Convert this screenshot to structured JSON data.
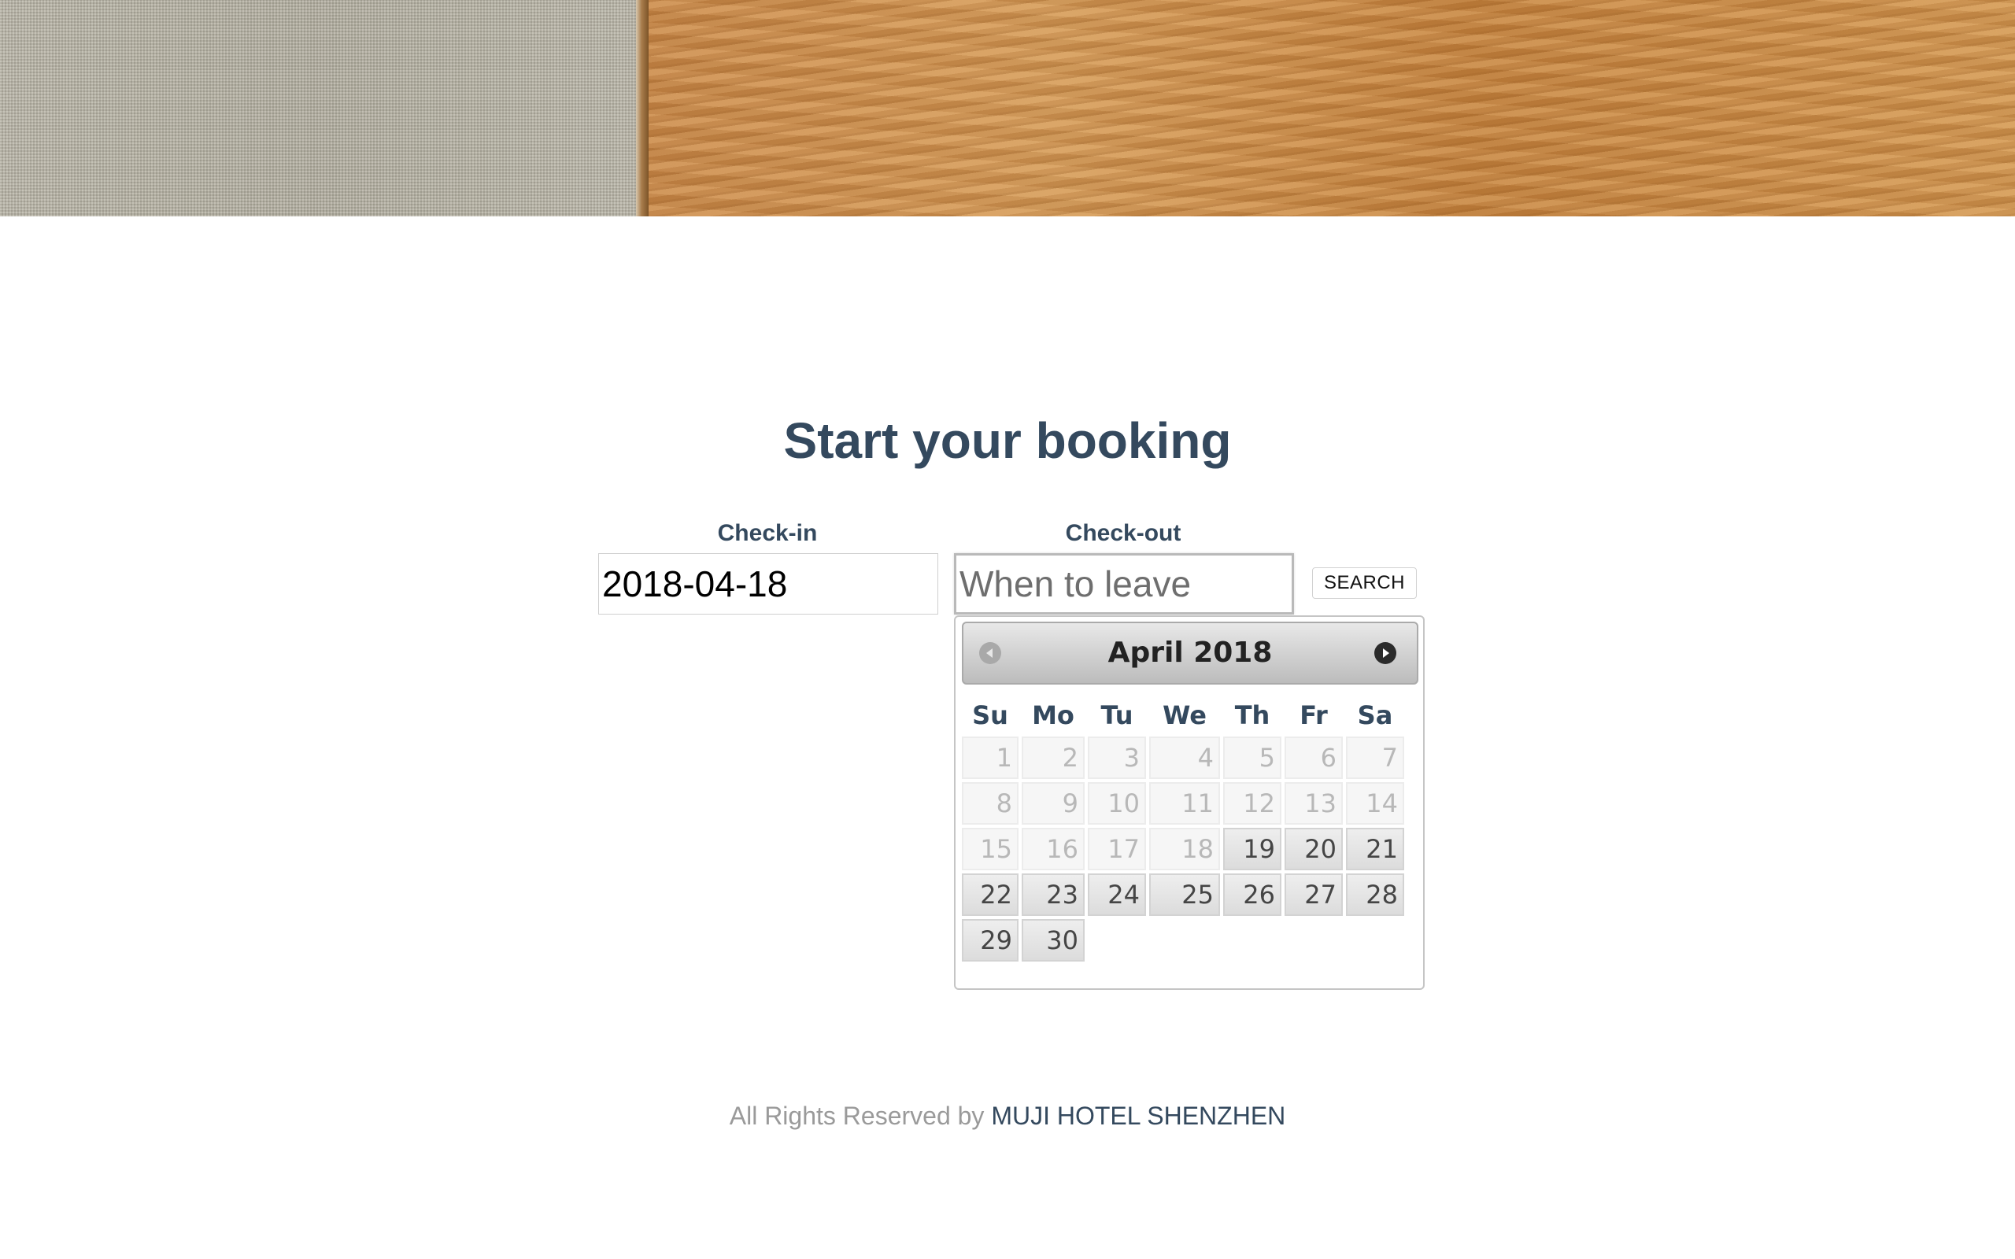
{
  "header": {
    "banner_left": "linen-texture",
    "banner_right": "wood-texture"
  },
  "main": {
    "title": "Start your booking"
  },
  "form": {
    "checkin_label": "Check-in",
    "checkin_value": "2018-04-18",
    "checkout_label": "Check-out",
    "checkout_placeholder": "When to leave",
    "search_label": "SEARCH"
  },
  "datepicker": {
    "month_title": "April 2018",
    "prev_icon": "chevron-left-icon",
    "next_icon": "chevron-right-icon",
    "weekdays": [
      "Su",
      "Mo",
      "Tu",
      "We",
      "Th",
      "Fr",
      "Sa"
    ],
    "weeks": [
      [
        {
          "d": "1",
          "s": "disabled"
        },
        {
          "d": "2",
          "s": "disabled"
        },
        {
          "d": "3",
          "s": "disabled"
        },
        {
          "d": "4",
          "s": "disabled"
        },
        {
          "d": "5",
          "s": "disabled"
        },
        {
          "d": "6",
          "s": "disabled"
        },
        {
          "d": "7",
          "s": "disabled"
        }
      ],
      [
        {
          "d": "8",
          "s": "disabled"
        },
        {
          "d": "9",
          "s": "disabled"
        },
        {
          "d": "10",
          "s": "disabled"
        },
        {
          "d": "11",
          "s": "disabled"
        },
        {
          "d": "12",
          "s": "disabled"
        },
        {
          "d": "13",
          "s": "disabled"
        },
        {
          "d": "14",
          "s": "disabled"
        }
      ],
      [
        {
          "d": "15",
          "s": "disabled"
        },
        {
          "d": "16",
          "s": "disabled"
        },
        {
          "d": "17",
          "s": "disabled"
        },
        {
          "d": "18",
          "s": "disabled"
        },
        {
          "d": "19",
          "s": "active"
        },
        {
          "d": "20",
          "s": "active"
        },
        {
          "d": "21",
          "s": "active"
        }
      ],
      [
        {
          "d": "22",
          "s": "active"
        },
        {
          "d": "23",
          "s": "active"
        },
        {
          "d": "24",
          "s": "active"
        },
        {
          "d": "25",
          "s": "active"
        },
        {
          "d": "26",
          "s": "active"
        },
        {
          "d": "27",
          "s": "active"
        },
        {
          "d": "28",
          "s": "active"
        }
      ],
      [
        {
          "d": "29",
          "s": "active"
        },
        {
          "d": "30",
          "s": "active"
        },
        {
          "d": "",
          "s": "empty"
        },
        {
          "d": "",
          "s": "empty"
        },
        {
          "d": "",
          "s": "empty"
        },
        {
          "d": "",
          "s": "empty"
        },
        {
          "d": "",
          "s": "empty"
        }
      ]
    ]
  },
  "footer": {
    "text": "All Rights Reserved by ",
    "link": "MUJI HOTEL SHENZHEN"
  },
  "colors": {
    "heading": "#34495e",
    "muted": "#9a9a9a",
    "disabled_day": "#b8b8b8"
  }
}
